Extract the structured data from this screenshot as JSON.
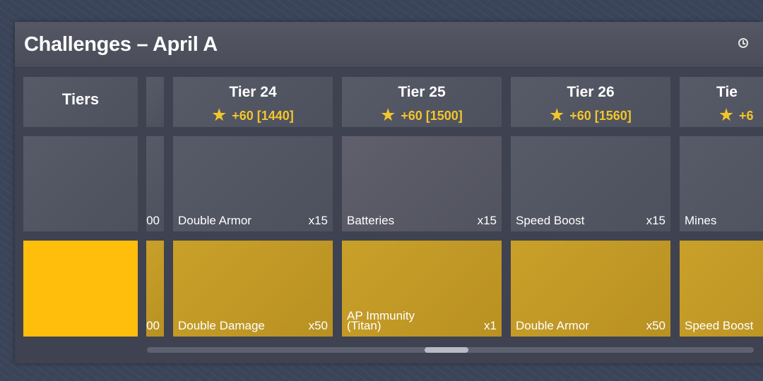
{
  "window": {
    "title": "Challenges – April A",
    "clock_icon": "clock-icon"
  },
  "tiers_column": {
    "label": "Tiers"
  },
  "partial_tier": {
    "free_count_fragment": "00",
    "premium_count_fragment": "00"
  },
  "tiers": [
    {
      "name": "Tier 24",
      "points": "+60 [1440]",
      "free_reward": {
        "name": "Double Armor",
        "count": "x15"
      },
      "premium_reward": {
        "name": "Double Damage",
        "count": "x50"
      }
    },
    {
      "name": "Tier 25",
      "points": "+60 [1500]",
      "free_reward": {
        "name": "Batteries",
        "count": "x15"
      },
      "premium_reward": {
        "name": "AP Immunity (Titan)",
        "count": "x1"
      }
    },
    {
      "name": "Tier 26",
      "points": "+60 [1560]",
      "free_reward": {
        "name": "Speed Boost",
        "count": "x15"
      },
      "premium_reward": {
        "name": "Double Armor",
        "count": "x50"
      }
    },
    {
      "name": "Tie",
      "points": "+6",
      "free_reward": {
        "name": "Mines",
        "count": ""
      },
      "premium_reward": {
        "name": "Speed Boost",
        "count": ""
      }
    }
  ],
  "colors": {
    "gold": "#c9a029",
    "gold_bright": "#ffbd0c",
    "star": "#f2c62a"
  },
  "scrollbar": {
    "position": 0.46
  }
}
